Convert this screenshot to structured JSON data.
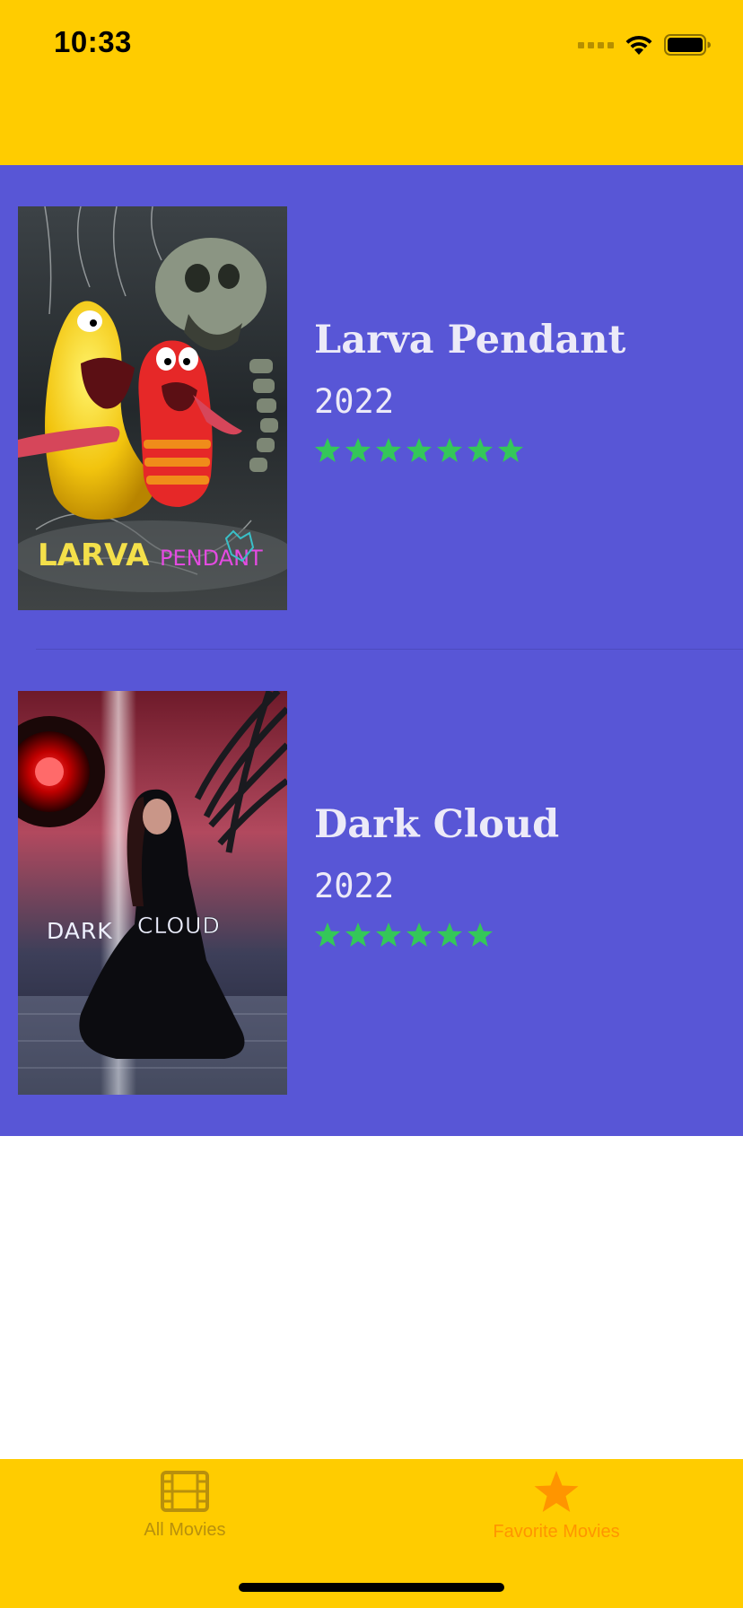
{
  "status_bar": {
    "time": "10:33"
  },
  "colors": {
    "header": "#FFCC00",
    "list_background": "#5856D6",
    "text": "#ECEAF8",
    "star": "#34C759",
    "tab_active": "#FF9500",
    "tab_inactive": "#b8900c"
  },
  "movies": [
    {
      "title": "Larva Pendant",
      "year": "2022",
      "rating_stars": 7,
      "poster_text": [
        "LARVA",
        "PENDANT"
      ]
    },
    {
      "title": "Dark Cloud",
      "year": "2022",
      "rating_stars": 6,
      "poster_text": [
        "DARK",
        "CLOUD"
      ]
    }
  ],
  "tab_bar": {
    "tabs": [
      {
        "label": "All Movies",
        "icon": "film-icon",
        "selected": false
      },
      {
        "label": "Favorite Movies",
        "icon": "star-icon",
        "selected": true
      }
    ]
  }
}
